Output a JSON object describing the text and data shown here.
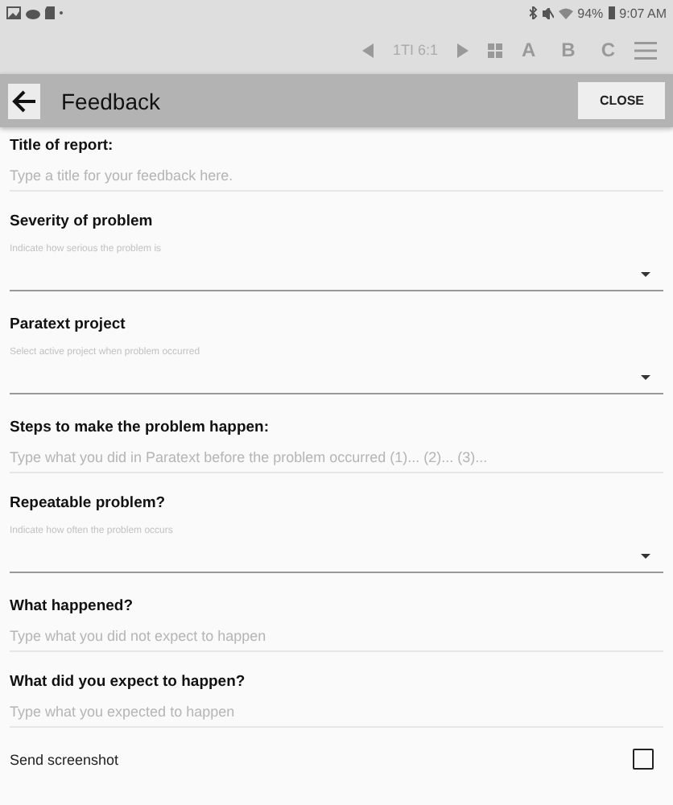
{
  "status_bar": {
    "battery": "94%",
    "time": "9:07 AM"
  },
  "toolbar": {
    "reference": "1TI 6:1",
    "letters": [
      "A",
      "B",
      "C"
    ]
  },
  "header": {
    "title": "Feedback",
    "close": "CLOSE"
  },
  "fields": [
    {
      "kind": "text",
      "label": "Title of report:",
      "placeholder": "Type a title for your feedback here."
    },
    {
      "kind": "select",
      "label": "Severity of problem",
      "hint": "Indicate how serious the problem is"
    },
    {
      "kind": "select",
      "label": "Paratext project",
      "hint": "Select active project when problem occurred"
    },
    {
      "kind": "text",
      "label": "Steps to make the problem happen:",
      "placeholder": "Type what you did in Paratext before the problem occurred (1)... (2)... (3)..."
    },
    {
      "kind": "select",
      "label": "Repeatable problem?",
      "hint": "Indicate how often the problem occurs"
    },
    {
      "kind": "text",
      "label": "What happened?",
      "placeholder": "Type what you did not expect to happen"
    },
    {
      "kind": "text",
      "label": "What did you expect to happen?",
      "placeholder": "Type what you expected to happen"
    }
  ],
  "screenshot": {
    "label": "Send screenshot",
    "checked": false
  }
}
